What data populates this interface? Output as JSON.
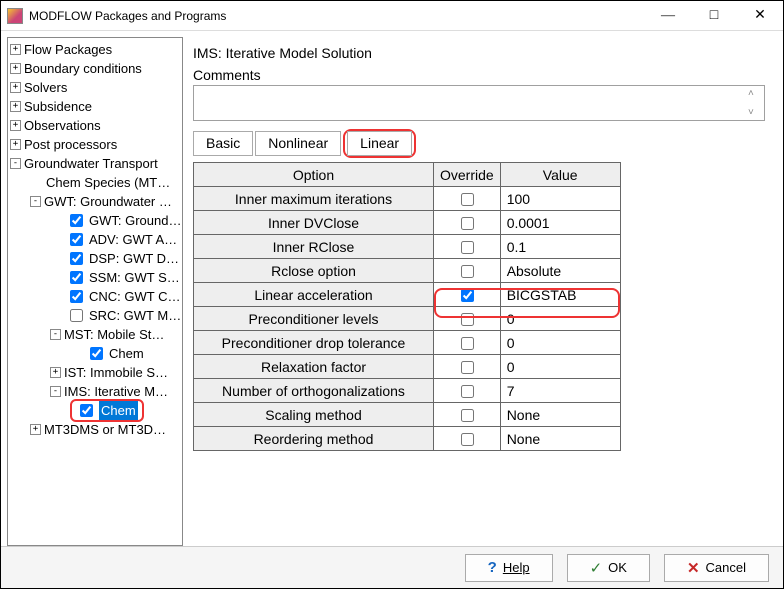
{
  "window": {
    "title": "MODFLOW Packages and Programs"
  },
  "tree": {
    "flow_packages": "Flow Packages",
    "boundary_conditions": "Boundary conditions",
    "solvers": "Solvers",
    "subsidence": "Subsidence",
    "observations": "Observations",
    "post_processors": "Post processors",
    "gw_transport": "Groundwater Transport",
    "chem_species": "Chem Species (MT…",
    "gwt_groundwater": "GWT: Groundwater …",
    "gwt_ground": "GWT: Ground…",
    "adv": "ADV: GWT A…",
    "dsp": "DSP: GWT D…",
    "ssm": "SSM: GWT S…",
    "cnc": "CNC: GWT C…",
    "src": "SRC: GWT M…",
    "mst": "MST: Mobile St…",
    "mst_chem": "Chem",
    "ist": "IST: Immobile S…",
    "ims": "IMS: Iterative M…",
    "ims_chem": "Chem",
    "mt3dms": "MT3DMS or MT3D…"
  },
  "panel": {
    "title": "IMS: Iterative Model Solution",
    "comments_label": "Comments"
  },
  "tabs": {
    "basic": "Basic",
    "nonlinear": "Nonlinear",
    "linear": "Linear"
  },
  "grid": {
    "headers": {
      "option": "Option",
      "override": "Override",
      "value": "Value"
    },
    "rows": [
      {
        "option": "Inner maximum iterations",
        "override": false,
        "value": "100"
      },
      {
        "option": "Inner DVClose",
        "override": false,
        "value": "0.0001"
      },
      {
        "option": "Inner RClose",
        "override": false,
        "value": "0.1"
      },
      {
        "option": "Rclose option",
        "override": false,
        "value": "Absolute"
      },
      {
        "option": "Linear acceleration",
        "override": true,
        "value": "BICGSTAB"
      },
      {
        "option": "Preconditioner levels",
        "override": false,
        "value": "0"
      },
      {
        "option": "Preconditioner drop tolerance",
        "override": false,
        "value": "0"
      },
      {
        "option": "Relaxation factor",
        "override": false,
        "value": "0"
      },
      {
        "option": "Number of orthogonalizations",
        "override": false,
        "value": "7"
      },
      {
        "option": "Scaling method",
        "override": false,
        "value": "None"
      },
      {
        "option": "Reordering method",
        "override": false,
        "value": "None"
      }
    ]
  },
  "buttons": {
    "help": "Help",
    "ok": "OK",
    "cancel": "Cancel"
  }
}
